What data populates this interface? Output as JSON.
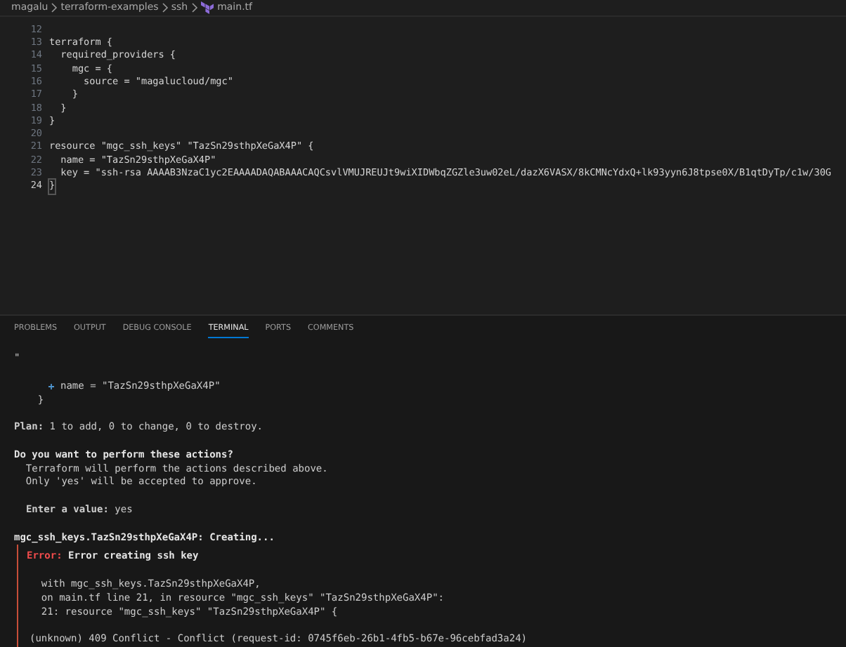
{
  "breadcrumb": [
    "magalu",
    "terraform-examples",
    "ssh",
    "main.tf"
  ],
  "editor": {
    "lines": [
      {
        "number": "12",
        "current": false
      },
      {
        "number": "13",
        "text": "terraform {",
        "current": false
      },
      {
        "number": "14",
        "text": "  required_providers {",
        "current": false
      },
      {
        "number": "15",
        "text": "    mgc = {",
        "current": false
      },
      {
        "number": "16",
        "text": "      source = \"magalucloud/mgc\"",
        "current": false
      },
      {
        "number": "17",
        "text": "    }",
        "current": false
      },
      {
        "number": "18",
        "text": "  }",
        "current": false
      },
      {
        "number": "19",
        "text": "}",
        "current": false
      },
      {
        "number": "20",
        "current": false
      },
      {
        "number": "21",
        "text": "resource \"mgc_ssh_keys\" \"TazSn29sthpXeGaX4P\" {",
        "current": false
      },
      {
        "number": "22",
        "text": "  name = \"TazSn29sthpXeGaX4P\"",
        "current": false
      },
      {
        "number": "23",
        "text": "  key = \"ssh-rsa AAAAB3NzaC1yc2EAAAADAQABAAACAQCsvlVMUJREUJt9wiXIDWbqZGZle3uw02eL/dazX6VASX/8kCMNcYdxQ+lk93yyn6J8tpse0X/B1qtDyTp/c1w/30G",
        "current": false
      },
      {
        "number": "24",
        "text": "}",
        "current": true
      }
    ]
  },
  "panel_tabs": [
    {
      "label": "PROBLEMS",
      "selected": false
    },
    {
      "label": "OUTPUT",
      "selected": false
    },
    {
      "label": "DEBUG CONSOLE",
      "selected": false
    },
    {
      "label": "TERMINAL",
      "selected": true
    },
    {
      "label": "PORTS",
      "selected": false
    },
    {
      "label": "COMMENTS",
      "selected": false
    }
  ],
  "terminal": [
    {
      "kind": "text",
      "text": "\""
    },
    {
      "kind": "blank"
    },
    {
      "kind": "add",
      "text": "name = \"TazSn29sthpXeGaX4P\""
    },
    {
      "kind": "text",
      "text": "    }"
    },
    {
      "kind": "blank"
    },
    {
      "kind": "text",
      "text": "**Plan:** 1 to add, 0 to change, 0 to destroy."
    },
    {
      "kind": "blank"
    },
    {
      "kind": "bold",
      "text": "Do you want to perform these actions?"
    },
    {
      "kind": "text",
      "text": "  Terraform will perform the actions described above."
    },
    {
      "kind": "text",
      "text": "  Only 'yes' will be accepted to approve."
    },
    {
      "kind": "blank"
    },
    {
      "kind": "text",
      "text": "  **Enter a value:** yes"
    },
    {
      "kind": "blank"
    },
    {
      "kind": "bold",
      "text": "mgc_ssh_keys.TazSn29sthpXeGaX4P: Creating..."
    },
    {
      "kind": "error",
      "label": "Error:",
      "text": "Error creating ssh key",
      "details": [
        {
          "kind": "blank"
        },
        {
          "kind": "text",
          "text": "  with mgc_ssh_keys.TazSn29sthpXeGaX4P,"
        },
        {
          "kind": "text",
          "text": "  on main.tf line 21, in resource \"mgc_ssh_keys\" \"TazSn29sthpXeGaX4P\":"
        },
        {
          "kind": "text",
          "text": "  21: resource \"mgc_ssh_keys\" \"TazSn29sthpXeGaX4P\" {"
        },
        {
          "kind": "blank"
        },
        {
          "kind": "text",
          "text": "(unknown) 409 Conflict - Conflict (request-id: 0745f6eb-26b1-4fb5-b67e-96cebfad3a24)"
        }
      ]
    }
  ]
}
